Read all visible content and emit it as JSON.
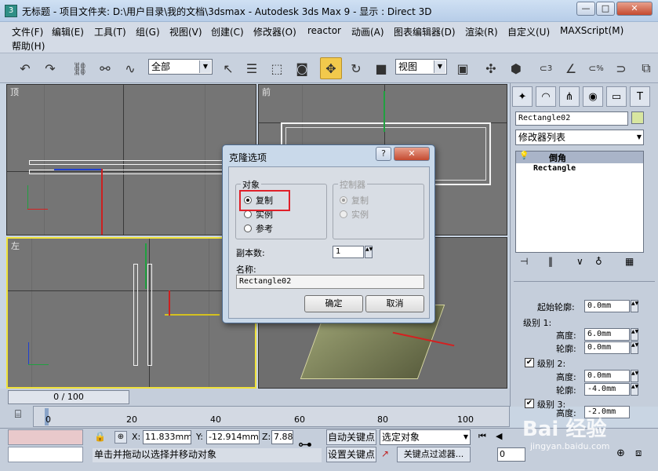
{
  "window": {
    "title": "无标题      - 项目文件夹: D:\\用户目录\\我的文档\\3dsmax      - Autodesk 3ds Max 9      - 显示 : Direct 3D",
    "app_icon": "3ds-max-icon",
    "minimize": "—",
    "maximize": "□",
    "close": "✕"
  },
  "menu": [
    "文件(F)",
    "编辑(E)",
    "工具(T)",
    "组(G)",
    "视图(V)",
    "创建(C)",
    "修改器(O)",
    "reactor",
    "动画(A)",
    "图表编辑器(D)",
    "渲染(R)",
    "自定义(U)",
    "MAXScript(M)",
    "帮助(H)"
  ],
  "toolbar": {
    "selection_filter": "全部",
    "reference_coord": "视图",
    "snap_labels": [
      "3",
      "%"
    ]
  },
  "viewports": {
    "top": "顶",
    "front": "前",
    "left": "左",
    "perspective": ""
  },
  "command_panel": {
    "object_name": "Rectangle02",
    "modifier_list": "修改器列表",
    "stack": [
      "倒角",
      "Rectangle"
    ],
    "params": {
      "start_outline_label": "起始轮廓:",
      "start_outline_value": "0.0mm",
      "level1_label": "级别 1:",
      "height_label": "高度:",
      "outline_label": "轮廓:",
      "l1_height": "6.0mm",
      "l1_outline": "0.0mm",
      "level2_label": "级别 2:",
      "l2_height": "0.0mm",
      "l2_outline": "-4.0mm",
      "level3_label": "级别 3:",
      "l3_height": "-2.0mm",
      "level2_checked": "✔",
      "level3_checked": "✔"
    }
  },
  "timeline": {
    "slider": "0 / 100",
    "ticks": [
      "0",
      "20",
      "40",
      "60",
      "80",
      "100"
    ]
  },
  "status": {
    "x_label": "X:",
    "x_value": "11.833mm",
    "y_label": "Y:",
    "y_value": "-12.914mm",
    "z_label": "Z:",
    "z_value": "7.88",
    "auto_key": "自动关键点",
    "set_key": "设置关键点",
    "key_mode": "选定对象",
    "key_filters": "关键点过滤器...",
    "frame": "0",
    "prompt": "单击并拖动以选择并移动对象",
    "watermark": "Bai 经验",
    "watermark_url": "jingyan.baidu.com"
  },
  "dialog": {
    "title": "克隆选项",
    "help": "?",
    "close": "✕",
    "object_group": "对象",
    "object_options": [
      "复制",
      "实例",
      "参考"
    ],
    "controller_group": "控制器",
    "controller_options": [
      "复制",
      "实例"
    ],
    "copies_label": "副本数:",
    "copies_value": "1",
    "name_label": "名称:",
    "name_value": "Rectangle02",
    "ok": "确定",
    "cancel": "取消"
  },
  "colors": {
    "highlight_box": "#e0202a",
    "active_viewport": "#f0e23a",
    "axis_x": "#d42020",
    "axis_y": "#20a040",
    "axis_z": "#2040d0"
  }
}
